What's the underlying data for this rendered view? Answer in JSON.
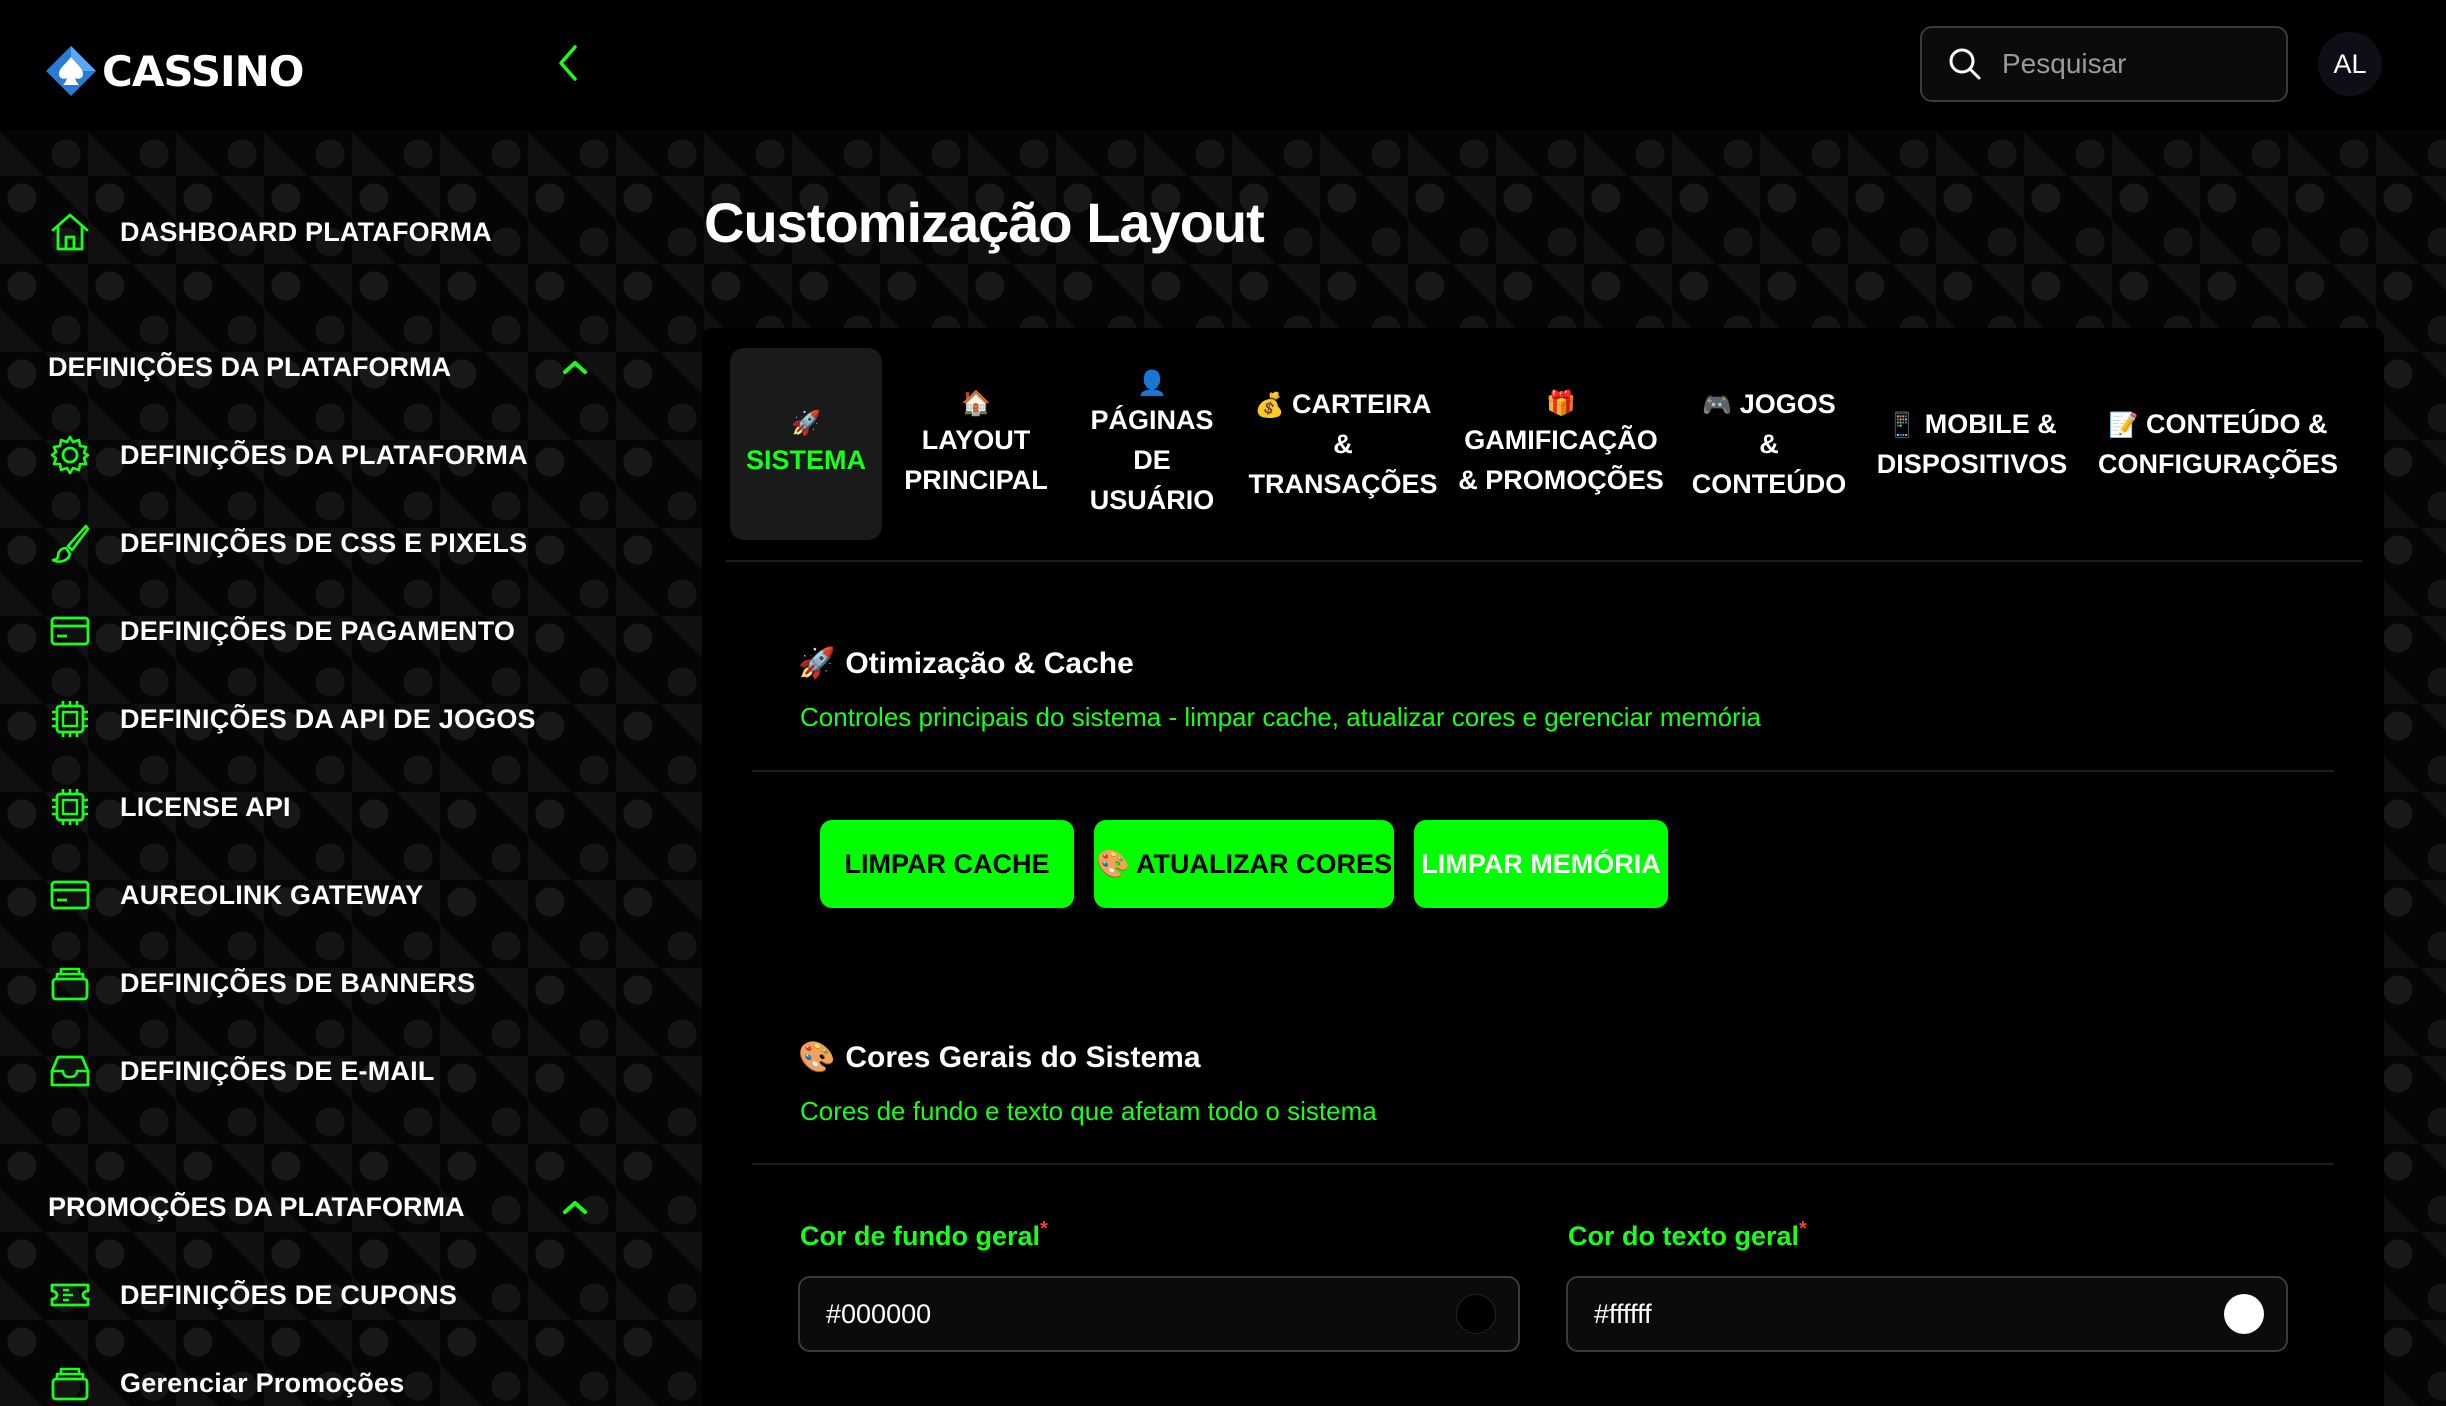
{
  "app": {
    "logo_text": "CASSINO"
  },
  "header": {
    "search": {
      "placeholder": "Pesquisar"
    },
    "avatar_initials": "AL"
  },
  "sidebar": {
    "dashboard_label": "DASHBOARD PLATAFORMA",
    "sections": [
      {
        "title": "DEFINIÇÕES DA PLATAFORMA",
        "items": [
          {
            "label": "DEFINIÇÕES DA PLATAFORMA",
            "icon": "gear-icon"
          },
          {
            "label": "DEFINIÇÕES DE CSS E PIXELS",
            "icon": "brush-icon"
          },
          {
            "label": "DEFINIÇÕES DE PAGAMENTO",
            "icon": "credit-card-icon"
          },
          {
            "label": "DEFINIÇÕES DA API DE JOGOS",
            "icon": "chip-icon"
          },
          {
            "label": "LICENSE API",
            "icon": "chip-icon"
          },
          {
            "label": "AUREOLINK GATEWAY",
            "icon": "credit-card-icon"
          },
          {
            "label": "DEFINIÇÕES DE BANNERS",
            "icon": "stack-icon"
          },
          {
            "label": "DEFINIÇÕES DE E-MAIL",
            "icon": "inbox-icon"
          }
        ]
      },
      {
        "title": "PROMOÇÕES DA PLATAFORMA",
        "items": [
          {
            "label": "DEFINIÇÕES DE CUPONS",
            "icon": "ticket-icon"
          },
          {
            "label": "Gerenciar Promoções",
            "icon": "stack-icon"
          }
        ]
      }
    ]
  },
  "main": {
    "page_title": "Customização Layout",
    "tabs": [
      {
        "emoji": "🚀",
        "lines": [
          "SISTEMA"
        ],
        "active": true
      },
      {
        "emoji": "🏠",
        "lines": [
          "LAYOUT",
          "PRINCIPAL"
        ]
      },
      {
        "emoji": "👤",
        "lines": [
          "PÁGINAS",
          "DE",
          "USUÁRIO"
        ]
      },
      {
        "emoji": "💰",
        "lines": [
          "CARTEIRA",
          "&",
          "TRANSAÇÕES"
        ],
        "inline_emoji": true
      },
      {
        "emoji": "🎁",
        "lines": [
          "GAMIFICAÇÃO",
          "& PROMOÇÕES"
        ]
      },
      {
        "emoji": "🎮",
        "lines": [
          "JOGOS",
          "&",
          "CONTEÚDO"
        ],
        "inline_emoji": true
      },
      {
        "emoji": "📱",
        "lines": [
          "MOBILE &",
          "DISPOSITIVOS"
        ],
        "inline_emoji": true
      },
      {
        "emoji": "📝",
        "lines": [
          "CONTEÚDO &",
          "CONFIGURAÇÕES"
        ],
        "inline_emoji": true
      }
    ],
    "cache_section": {
      "emoji": "🚀",
      "title": "Otimização & Cache",
      "subtitle": "Controles principais do sistema - limpar cache, atualizar cores e gerenciar memória",
      "buttons": {
        "clear_cache": "LIMPAR CACHE",
        "update_colors": "🎨 ATUALIZAR CORES",
        "clear_memory": "LIMPAR MEMÓRIA"
      }
    },
    "colors_section": {
      "emoji": "🎨",
      "title": "Cores Gerais do Sistema",
      "subtitle": "Cores de fundo e texto que afetam todo o sistema",
      "fields": {
        "bg_label": "Cor de fundo geral",
        "bg_value": "#000000",
        "text_label": "Cor do texto geral",
        "text_value": "#ffffff",
        "required_mark": "*"
      }
    }
  },
  "colors": {
    "accent": "#00ff00",
    "accent_text": "#1aff1a",
    "background": "#000000",
    "required": "#ff3b3b"
  }
}
